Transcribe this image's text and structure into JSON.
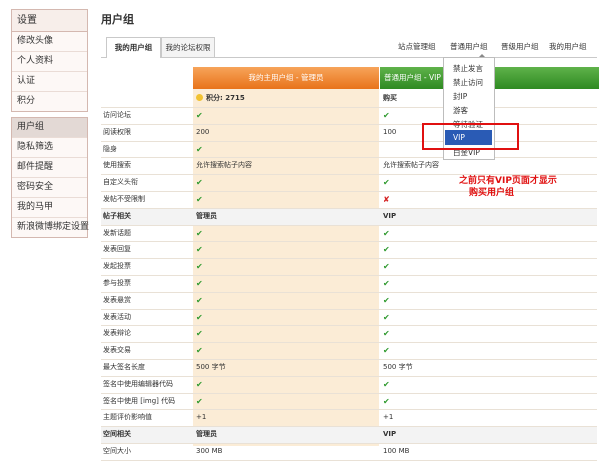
{
  "sidebar": {
    "title": "设置",
    "group1": [
      "修改头像",
      "个人资料",
      "认证",
      "积分"
    ],
    "group2": [
      "用户组",
      "隐私筛选",
      "邮件提醒",
      "密码安全",
      "我的马甲",
      "新浪微博绑定设置"
    ]
  },
  "page_title": "用户组",
  "tabs": {
    "my_group": "我的用户组",
    "forum_perm": "我的论坛权限",
    "links": [
      "站点管理组",
      "普通用户组",
      "晋级用户组",
      "我的用户组"
    ]
  },
  "columns": {
    "main": "我的主用户组 - 管理员",
    "normal": "普通用户组 - VIP"
  },
  "points": {
    "label": "积分:",
    "value": "2715",
    "buy": "购买"
  },
  "rows": [
    {
      "label": "访问论坛",
      "c1": "✔",
      "c2": "✔"
    },
    {
      "label": "阅读权限",
      "c1": "200",
      "c2": "100"
    },
    {
      "label": "隐身",
      "c1": "✔",
      "c2": ""
    },
    {
      "label": "使用搜索",
      "c1": "允许搜索帖子内容",
      "c2": "允许搜索帖子内容"
    },
    {
      "label": "自定义头衔",
      "c1": "✔",
      "c2": "✔"
    },
    {
      "label": "发帖不受限制",
      "c1": "✔",
      "c2": "✘"
    },
    {
      "label": "帖子相关",
      "c1": "管理员",
      "c2": "VIP",
      "section": true
    },
    {
      "label": "发新话题",
      "c1": "✔",
      "c2": "✔"
    },
    {
      "label": "发表回复",
      "c1": "✔",
      "c2": "✔"
    },
    {
      "label": "发起投票",
      "c1": "✔",
      "c2": "✔"
    },
    {
      "label": "参与投票",
      "c1": "✔",
      "c2": "✔"
    },
    {
      "label": "发表悬赏",
      "c1": "✔",
      "c2": "✔"
    },
    {
      "label": "发表活动",
      "c1": "✔",
      "c2": "✔"
    },
    {
      "label": "发表辩论",
      "c1": "✔",
      "c2": "✔"
    },
    {
      "label": "发表交易",
      "c1": "✔",
      "c2": "✔"
    },
    {
      "label": "最大签名长度",
      "c1": "500 字节",
      "c2": "500 字节"
    },
    {
      "label": "签名中使用编辑器代码",
      "c1": "✔",
      "c2": "✔"
    },
    {
      "label": "签名中使用 [img] 代码",
      "c1": "✔",
      "c2": "✔"
    },
    {
      "label": "主题评价影响值",
      "c1": "+1",
      "c2": "+1"
    },
    {
      "label": "空间相关",
      "c1": "管理员",
      "c2": "VIP",
      "section": true
    },
    {
      "label": "空间大小",
      "c1": "300 MB",
      "c2": "100 MB"
    }
  ],
  "dropdown": [
    "禁止发言",
    "禁止访问",
    "封IP",
    "游客",
    "等待验证",
    "VIP",
    "白金VIP"
  ],
  "annotation": {
    "line1": "之前只有VIP页面才显示",
    "line2": "购买用户组"
  },
  "colors": {
    "accent_orange": "#e8731a",
    "accent_green": "#2e8a22",
    "annotation_red": "#e01010"
  }
}
